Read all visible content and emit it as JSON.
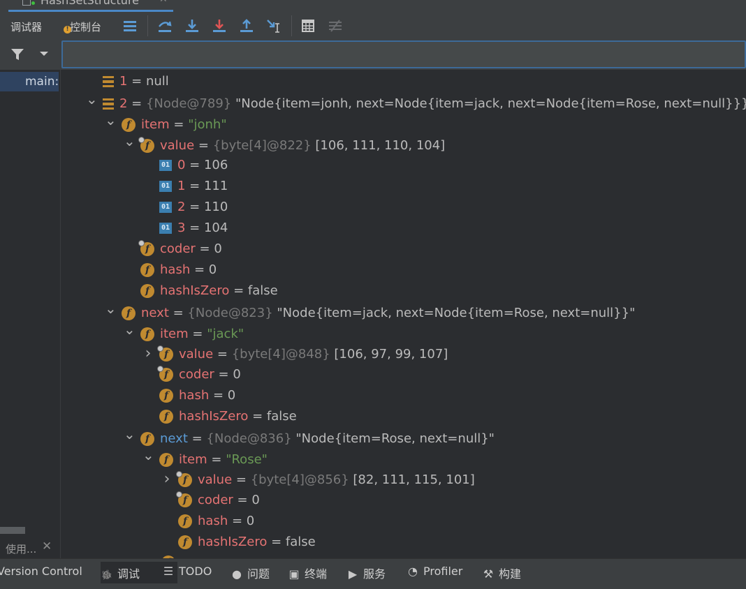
{
  "window": {
    "file_tab": "HashSetStructure"
  },
  "toolbar": {
    "tab_debugger": "调试器",
    "tab_console": "控制台",
    "buttons": [
      "layout-icon",
      "step-over-icon",
      "step-into-icon",
      "force-step-into-icon",
      "step-out-icon",
      "run-to-cursor-icon",
      "evaluate-icon",
      "trace-icon"
    ]
  },
  "frames": {
    "selected": "main:"
  },
  "left_tab": "使用...",
  "variables": [
    {
      "depth": 0,
      "expand": "",
      "icon": "array",
      "name": "1",
      "type": "",
      "value": "null",
      "is_string": false
    },
    {
      "depth": 0,
      "expand": "open",
      "icon": "array",
      "name": "2",
      "type": "{Node@789}",
      "value": "\"Node{item=jonh, next=Node{item=jack, next=Node{item=Rose, next=null}}}\"",
      "is_string": false
    },
    {
      "depth": 1,
      "expand": "open",
      "icon": "field",
      "name": "item",
      "type": "",
      "value": "\"jonh\"",
      "is_string": true
    },
    {
      "depth": 2,
      "expand": "open",
      "icon": "field-locked",
      "name": "value",
      "type": "{byte[4]@822}",
      "value": "[106, 111, 110, 104]",
      "is_string": false
    },
    {
      "depth": 3,
      "expand": "",
      "icon": "prim",
      "name": "0",
      "type": "",
      "value": "106",
      "is_string": false
    },
    {
      "depth": 3,
      "expand": "",
      "icon": "prim",
      "name": "1",
      "type": "",
      "value": "111",
      "is_string": false
    },
    {
      "depth": 3,
      "expand": "",
      "icon": "prim",
      "name": "2",
      "type": "",
      "value": "110",
      "is_string": false
    },
    {
      "depth": 3,
      "expand": "",
      "icon": "prim",
      "name": "3",
      "type": "",
      "value": "104",
      "is_string": false
    },
    {
      "depth": 2,
      "expand": "",
      "icon": "field-locked",
      "name": "coder",
      "type": "",
      "value": "0",
      "is_string": false
    },
    {
      "depth": 2,
      "expand": "",
      "icon": "field",
      "name": "hash",
      "type": "",
      "value": "0",
      "is_string": false
    },
    {
      "depth": 2,
      "expand": "",
      "icon": "field",
      "name": "hashIsZero",
      "type": "",
      "value": "false",
      "is_string": false
    },
    {
      "depth": 1,
      "expand": "open",
      "icon": "field",
      "name": "next",
      "type": "{Node@823}",
      "value": "\"Node{item=jack, next=Node{item=Rose, next=null}}\"",
      "is_string": false
    },
    {
      "depth": 2,
      "expand": "open",
      "icon": "field",
      "name": "item",
      "type": "",
      "value": "\"jack\"",
      "is_string": true
    },
    {
      "depth": 3,
      "expand": "closed",
      "icon": "field-locked",
      "name": "value",
      "type": "{byte[4]@848}",
      "value": "[106, 97, 99, 107]",
      "is_string": false
    },
    {
      "depth": 3,
      "expand": "",
      "icon": "field-locked",
      "name": "coder",
      "type": "",
      "value": "0",
      "is_string": false
    },
    {
      "depth": 3,
      "expand": "",
      "icon": "field",
      "name": "hash",
      "type": "",
      "value": "0",
      "is_string": false
    },
    {
      "depth": 3,
      "expand": "",
      "icon": "field",
      "name": "hashIsZero",
      "type": "",
      "value": "false",
      "is_string": false
    },
    {
      "depth": 2,
      "expand": "open",
      "icon": "field",
      "name": "next",
      "type": "{Node@836}",
      "value": "\"Node{item=Rose, next=null}\"",
      "is_string": false,
      "blue": true
    },
    {
      "depth": 3,
      "expand": "open",
      "icon": "field",
      "name": "item",
      "type": "",
      "value": "\"Rose\"",
      "is_string": true
    },
    {
      "depth": 4,
      "expand": "closed",
      "icon": "field-locked",
      "name": "value",
      "type": "{byte[4]@856}",
      "value": "[82, 111, 115, 101]",
      "is_string": false
    },
    {
      "depth": 4,
      "expand": "",
      "icon": "field-locked",
      "name": "coder",
      "type": "",
      "value": "0",
      "is_string": false
    },
    {
      "depth": 4,
      "expand": "",
      "icon": "field",
      "name": "hash",
      "type": "",
      "value": "0",
      "is_string": false
    },
    {
      "depth": 4,
      "expand": "",
      "icon": "field",
      "name": "hashIsZero",
      "type": "",
      "value": "false",
      "is_string": false
    }
  ],
  "bottom_tabs": [
    {
      "label": "Version Control",
      "icon": ""
    },
    {
      "label": "调试",
      "icon": "bug-icon"
    },
    {
      "label": "TODO",
      "icon": "list-icon"
    },
    {
      "label": "问题",
      "icon": "warning-icon"
    },
    {
      "label": "终端",
      "icon": "terminal-icon"
    },
    {
      "label": "服务",
      "icon": "play-icon"
    },
    {
      "label": "Profiler",
      "icon": "profiler-icon"
    },
    {
      "label": "构建",
      "icon": "hammer-icon"
    }
  ]
}
